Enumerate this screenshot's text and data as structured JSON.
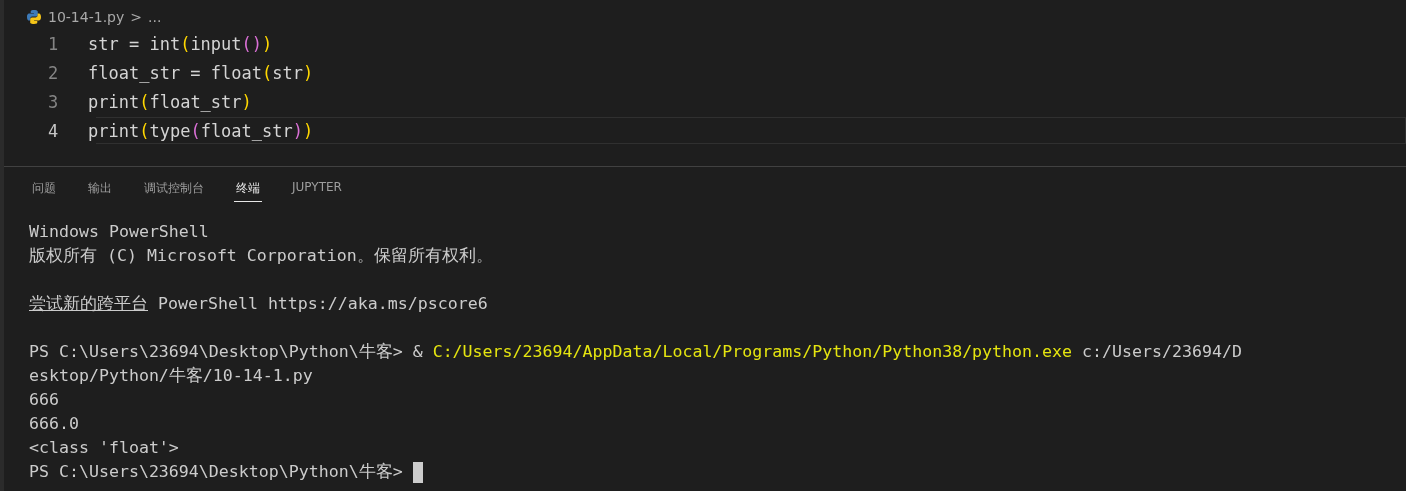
{
  "breadcrumb": {
    "file": "10-14-1.py",
    "separator": ">",
    "rest": "..."
  },
  "code_lines": [
    {
      "number": "1",
      "current": false,
      "tokens": [
        {
          "text": "str = int",
          "kind": "plain"
        },
        {
          "text": "(",
          "kind": "bracket1"
        },
        {
          "text": "input",
          "kind": "plain"
        },
        {
          "text": "()",
          "kind": "bracket2"
        },
        {
          "text": ")",
          "kind": "bracket1"
        }
      ]
    },
    {
      "number": "2",
      "current": false,
      "tokens": [
        {
          "text": "float_str = float",
          "kind": "plain"
        },
        {
          "text": "(",
          "kind": "bracket1"
        },
        {
          "text": "str",
          "kind": "plain"
        },
        {
          "text": ")",
          "kind": "bracket1"
        }
      ]
    },
    {
      "number": "3",
      "current": false,
      "tokens": [
        {
          "text": "print",
          "kind": "plain"
        },
        {
          "text": "(",
          "kind": "bracket1"
        },
        {
          "text": "float_str",
          "kind": "plain"
        },
        {
          "text": ")",
          "kind": "bracket1"
        }
      ]
    },
    {
      "number": "4",
      "current": true,
      "tokens": [
        {
          "text": "print",
          "kind": "plain"
        },
        {
          "text": "(",
          "kind": "bracket1"
        },
        {
          "text": "type",
          "kind": "plain"
        },
        {
          "text": "(",
          "kind": "bracket2"
        },
        {
          "text": "float_str",
          "kind": "plain"
        },
        {
          "text": ")",
          "kind": "bracket2"
        },
        {
          "text": ")",
          "kind": "bracket1"
        }
      ]
    }
  ],
  "panel_tabs": [
    {
      "label": "问题",
      "selected": false
    },
    {
      "label": "输出",
      "selected": false
    },
    {
      "label": "调试控制台",
      "selected": false
    },
    {
      "label": "终端",
      "selected": true
    },
    {
      "label": "JUPYTER",
      "selected": false
    }
  ],
  "terminal_lines": [
    [
      {
        "text": "Windows PowerShell",
        "kind": "plain"
      }
    ],
    [
      {
        "text": "版权所有 (C) Microsoft Corporation。保留所有权利。",
        "kind": "plain"
      }
    ],
    [
      {
        "kind": "blank"
      }
    ],
    [
      {
        "text": "尝试新的跨平台",
        "kind": "link"
      },
      {
        "text": " PowerShell https://aka.ms/pscore6",
        "kind": "plain"
      }
    ],
    [
      {
        "kind": "blank"
      }
    ],
    [
      {
        "text": "PS C:\\Users\\23694\\Desktop\\Python\\牛客> & ",
        "kind": "plain"
      },
      {
        "text": "C:/Users/23694/AppData/Local/Programs/Python/Python38/python.exe",
        "kind": "command"
      },
      {
        "text": " c:/Users/23694/D",
        "kind": "plain"
      }
    ],
    [
      {
        "text": "esktop/Python/牛客/10-14-1.py",
        "kind": "plain"
      }
    ],
    [
      {
        "text": "666",
        "kind": "plain"
      }
    ],
    [
      {
        "text": "666.0",
        "kind": "plain"
      }
    ],
    [
      {
        "text": "<class 'float'>",
        "kind": "plain"
      }
    ],
    [
      {
        "text": "PS C:\\Users\\23694\\Desktop\\Python\\牛客> ",
        "kind": "plain"
      },
      {
        "kind": "cursor"
      }
    ]
  ]
}
